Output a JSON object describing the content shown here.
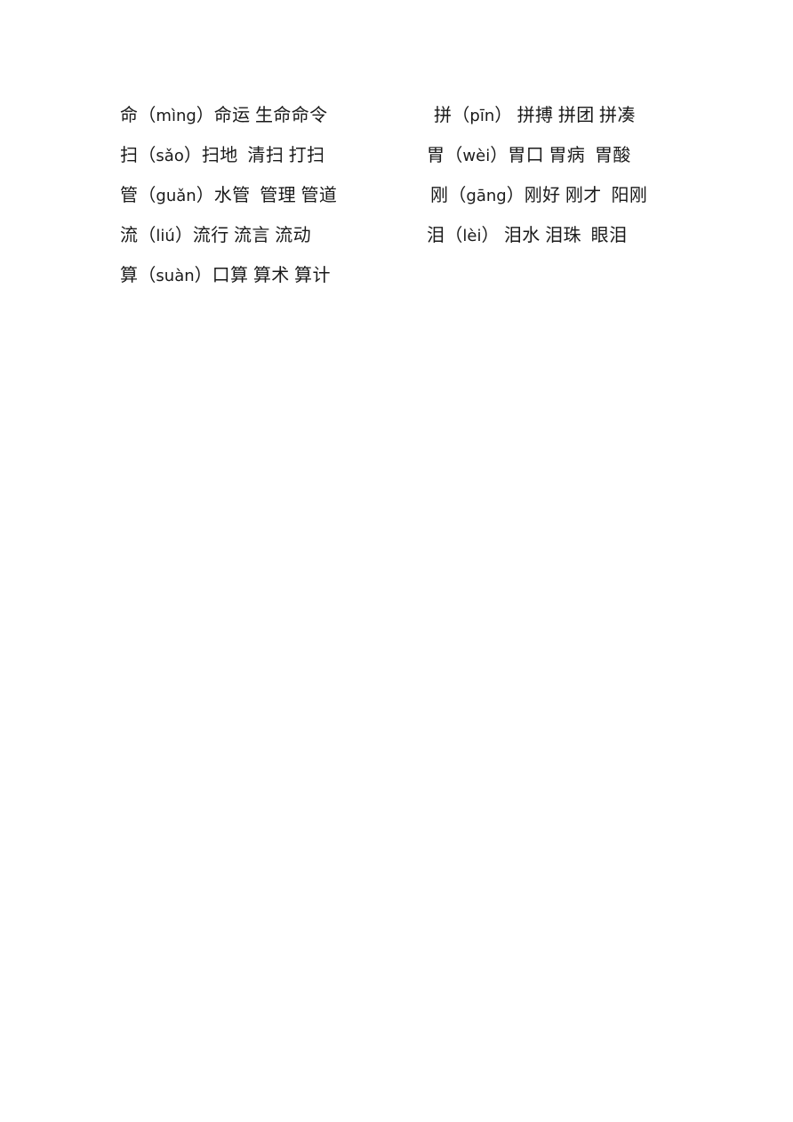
{
  "document": {
    "type": "chinese-vocabulary-worksheet",
    "page_background": "#ffffff",
    "text_color": "#1a1a1a",
    "columns": 2,
    "rows": [
      {
        "left": {
          "character": "命",
          "open_paren": "（",
          "pinyin": "mìng",
          "close_paren": "）",
          "words": "命运 生命命令",
          "lead_space": ""
        },
        "right": {
          "character": "拼",
          "open_paren": "（",
          "pinyin": "pīn",
          "close_paren": "）",
          "words": " 拼搏 拼团 拼凑",
          "lead_space": "  "
        }
      },
      {
        "left": {
          "character": "扫",
          "open_paren": "（",
          "pinyin": "sǎo",
          "close_paren": "）",
          "words": "扫地  清扫 打扫",
          "lead_space": ""
        },
        "right": {
          "character": "胃",
          "open_paren": "（",
          "pinyin": "wèi",
          "close_paren": "）",
          "words": "胃口 胃病  胃酸",
          "lead_space": ""
        }
      },
      {
        "left": {
          "character": "管",
          "open_paren": "（",
          "pinyin": "guǎn",
          "close_paren": "）",
          "words": "水管  管理 管道",
          "lead_space": ""
        },
        "right": {
          "character": "刚",
          "open_paren": "（",
          "pinyin": "gāng",
          "close_paren": "）",
          "words": "刚好 刚才  阳刚",
          "lead_space": " "
        }
      },
      {
        "left": {
          "character": "流",
          "open_paren": "（",
          "pinyin": "liú",
          "close_paren": "）",
          "words": "流行 流言 流动",
          "lead_space": ""
        },
        "right": {
          "character": "泪",
          "open_paren": "（",
          "pinyin": "lèi",
          "close_paren": "）",
          "words": " 泪水 泪珠  眼泪",
          "lead_space": ""
        }
      },
      {
        "left": {
          "character": "算",
          "open_paren": "（",
          "pinyin": "suàn",
          "close_paren": "）",
          "words": "口算 算术 算计",
          "lead_space": ""
        },
        "right": null
      }
    ]
  }
}
